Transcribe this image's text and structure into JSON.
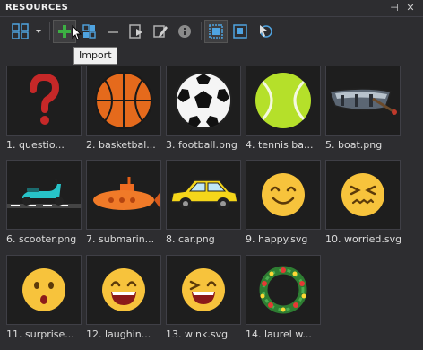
{
  "panel": {
    "title": "RESOURCES",
    "pin_glyph": "⊣",
    "close_glyph": "✕"
  },
  "toolbar": {
    "buttons": [
      {
        "name": "view-grid-icon",
        "active": false
      },
      {
        "name": "import-icon",
        "active": true
      },
      {
        "name": "add-folder-icon",
        "active": false
      },
      {
        "name": "remove-icon",
        "active": false
      },
      {
        "name": "play-icon",
        "active": false
      },
      {
        "name": "edit-icon",
        "active": false
      },
      {
        "name": "info-icon",
        "active": false
      },
      {
        "name": "image-icon",
        "active": true
      },
      {
        "name": "replace-icon",
        "active": false
      },
      {
        "name": "arrow-icon",
        "active": false
      }
    ]
  },
  "tooltip": {
    "text": "Import"
  },
  "resources": [
    {
      "label": "1. questio...",
      "icon": "question-icon"
    },
    {
      "label": "2. basketbal...",
      "icon": "basketball-icon"
    },
    {
      "label": "3. football.png",
      "icon": "football-icon"
    },
    {
      "label": "4. tennis ba...",
      "icon": "tennis-ball-icon"
    },
    {
      "label": "5. boat.png",
      "icon": "boat-icon"
    },
    {
      "label": "6. scooter.png",
      "icon": "scooter-icon"
    },
    {
      "label": "7. submarin...",
      "icon": "submarine-icon"
    },
    {
      "label": "8. car.png",
      "icon": "car-icon"
    },
    {
      "label": "9. happy.svg",
      "icon": "happy-face-icon"
    },
    {
      "label": "10. worried.svg",
      "icon": "worried-face-icon"
    },
    {
      "label": "11. surprise...",
      "icon": "surprised-face-icon"
    },
    {
      "label": "12. laughin...",
      "icon": "laughing-face-icon"
    },
    {
      "label": "13. wink.svg",
      "icon": "wink-face-icon"
    },
    {
      "label": "14. laurel w...",
      "icon": "laurel-wreath-icon"
    }
  ]
}
